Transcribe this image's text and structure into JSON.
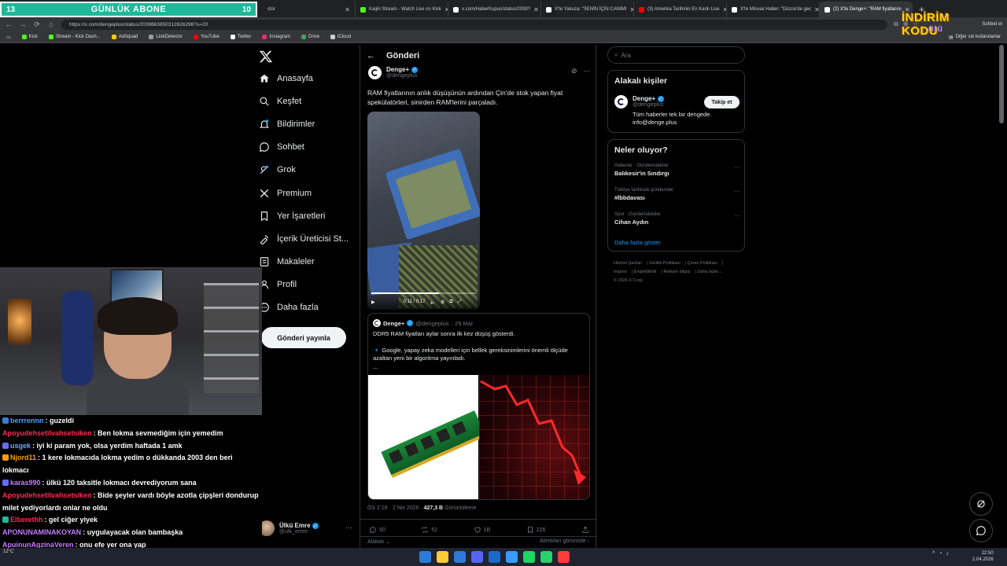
{
  "overlay": {
    "sub_left": "13",
    "sub_goal": "GÜNLÜK ABONE",
    "sub_right": "10",
    "promo_main": "İNDİRİM KODU",
    "promo_sub": "ütü"
  },
  "browser": {
    "tabs": [
      {
        "label": "ctor",
        "color": "#1d9bf0"
      },
      {
        "label": "Kaijiri Stream - Watch Live on Kick",
        "color": "#53fc18"
      },
      {
        "label": "x.com/HaberKupus/status/2039?",
        "color": "#ffffff"
      },
      {
        "label": "X'te Yakuza: \"SENİN İÇİN CANIMI",
        "color": "#ffffff"
      },
      {
        "label": "(3) Amerika Tarihinin En Kanlı Lise",
        "color": "#ff0000"
      },
      {
        "label": "X'te Misvak Haber: \"Düzce'de gec",
        "color": "#ffffff"
      },
      {
        "label": "(2) X'te Denge+: \"RAM fiyatlarını",
        "color": "#ffffff"
      }
    ],
    "url": "https://x.com/dengeplus/status/2039663850312626296?s=20",
    "bookmarks": [
      "Kick",
      "Stream - Kick Dash...",
      "AdSquad",
      "LinkDetector",
      "YouTube",
      "Twitter",
      "Instagram",
      "Drive",
      "iCloud"
    ],
    "bookmark_colors": [
      "#53fc18",
      "#53fc18",
      "#ffcc00",
      "#999999",
      "#ff0000",
      "#ffffff",
      "#e1306c",
      "#34a853",
      "#cccccc"
    ],
    "right_label": "Diğer sık kullanılanlar",
    "sidebar_label": "Sohbet et"
  },
  "chat": [
    {
      "user": "berrrennn",
      "msg": "guzeldi",
      "color": "#4aa3ff",
      "badge": "#3a7bd5"
    },
    {
      "user": "Apoyudehsetilvahsetsiken",
      "msg": "Ben lokma sevmediğim için yemedim",
      "color": "#ff2a55",
      "badge": ""
    },
    {
      "user": "usgek",
      "msg": "iyi ki param yok, olsa yerdim haftada 1 amk",
      "color": "#6aa9ff",
      "badge": "#6a6aff"
    },
    {
      "user": "Njord11",
      "msg": "1 kere lokmacıda lokma yedim o dükkanda 2003 den beri lokmacı",
      "color": "#ff9d00",
      "badge": "#ff9d00"
    },
    {
      "user": "karas990",
      "msg": "ülkü 120 taksitle lokmacı devrediyorum sana",
      "color": "#c77dff",
      "badge": "#6a6aff"
    },
    {
      "user": "Apoyudehsetilvahsetsiken",
      "msg": "Bide şeyler vardı böyle azotla çipşleri dondurup milet yediyorlardı onlar ne oldu",
      "color": "#ff2a55",
      "badge": ""
    },
    {
      "user": "Elberethh",
      "msg": "gel ciğer yiyek",
      "color": "#ff2a55",
      "badge": "#1fb89a"
    },
    {
      "user": "APONUNAMINAKOYAN",
      "msg": "uygulayacak olan bambaşka",
      "color": "#c77dff",
      "badge": ""
    },
    {
      "user": "ApuinunAgzinaVeren",
      "msg": "onu efe yer ona yap",
      "color": "#c77dff",
      "badge": ""
    }
  ],
  "nav": {
    "items": [
      {
        "label": "Anasayfa",
        "icon": "home-icon"
      },
      {
        "label": "Keşfet",
        "icon": "search-icon"
      },
      {
        "label": "Bildirimler",
        "icon": "bell-icon"
      },
      {
        "label": "Sohbet",
        "icon": "chat-icon"
      },
      {
        "label": "Grok",
        "icon": "grok-icon"
      },
      {
        "label": "Premium",
        "icon": "x-premium-icon"
      },
      {
        "label": "Yer İşaretleri",
        "icon": "bookmark-icon"
      },
      {
        "label": "İçerik Üreticisi St...",
        "icon": "creator-studio-icon"
      },
      {
        "label": "Makaleler",
        "icon": "article-icon"
      },
      {
        "label": "Profil",
        "icon": "person-icon"
      },
      {
        "label": "Daha fazla",
        "icon": "more-circle-icon"
      }
    ],
    "post_button": "Gönderi yayınla",
    "account_name": "Ülkü Emre",
    "account_handle": "@ulk_emre"
  },
  "post": {
    "header": "Gönderi",
    "author": "Denge+",
    "handle": "@dengeplus",
    "text": "RAM fiyatlarının anlık düşüşünün ardından Çin'de stok yapan fiyat spekülatörleri, sinirden RAM'lerini parçaladı.",
    "video_time": "0:11 / 0:17",
    "video_progress": 0.65,
    "quote": {
      "author": "Denge+",
      "handle": "@dengeplus",
      "date": "· 29 Mar",
      "line1": "DDR5 RAM fiyatları aylar sonra ilk kez düşüş gösterdi.",
      "line2": "🔹 Google, yapay zeka modelleri için bellek gereksinimlerini önemli ölçüde azaltan yeni bir algoritma yayınladı.",
      "line3": "..."
    },
    "time": "ÖS 2:18 · 2 Nis 2026 · ",
    "views": "427,3 B",
    "views_label": " Görüntüleme",
    "replies": "50",
    "reposts": "52",
    "likes": "1B",
    "bookmarks": "226",
    "related_left": "Alakalı",
    "related_right": "Alımtıları görüntüle"
  },
  "right": {
    "search_placeholder": "Ara",
    "related_title": "Alakalı kişiler",
    "related_name": "Denge+",
    "related_handle": "@dengeplus",
    "follow_label": "Takip et",
    "related_bio_1": "Tüm haberler tek bir dengede.",
    "related_bio_2": "info@denge.plus",
    "trends_title": "Neler oluyor?",
    "trends": [
      {
        "cat": "Haberler · Gündemdekiler",
        "name": "Balıkesir'in Sındırgı"
      },
      {
        "cat": "Türkiye tarihinde gündemde",
        "name": "#İbbdavası"
      },
      {
        "cat": "Spor · Gündemdekiler",
        "name": "Cihan Aydın"
      }
    ],
    "show_more": "Daha fazla göster",
    "footer": [
      "Hizmet Şartları",
      "Gizlilik Politikası",
      "Çerez Politikası",
      "Imprint",
      "Erişilebilirlik",
      "Reklam bilgisi",
      "Daha fazla ...",
      "© 2026 X Corp."
    ]
  },
  "taskbar": {
    "weather": "12°C",
    "time": "22:50",
    "date": "2.04.2026",
    "icon_colors": [
      "#2f7ad9",
      "#ffcc33",
      "#2f7ad9",
      "#5865f2",
      "#1b6ac9",
      "#3a9cff",
      "#1ed760",
      "#25d366",
      "#ff3b3b"
    ]
  }
}
